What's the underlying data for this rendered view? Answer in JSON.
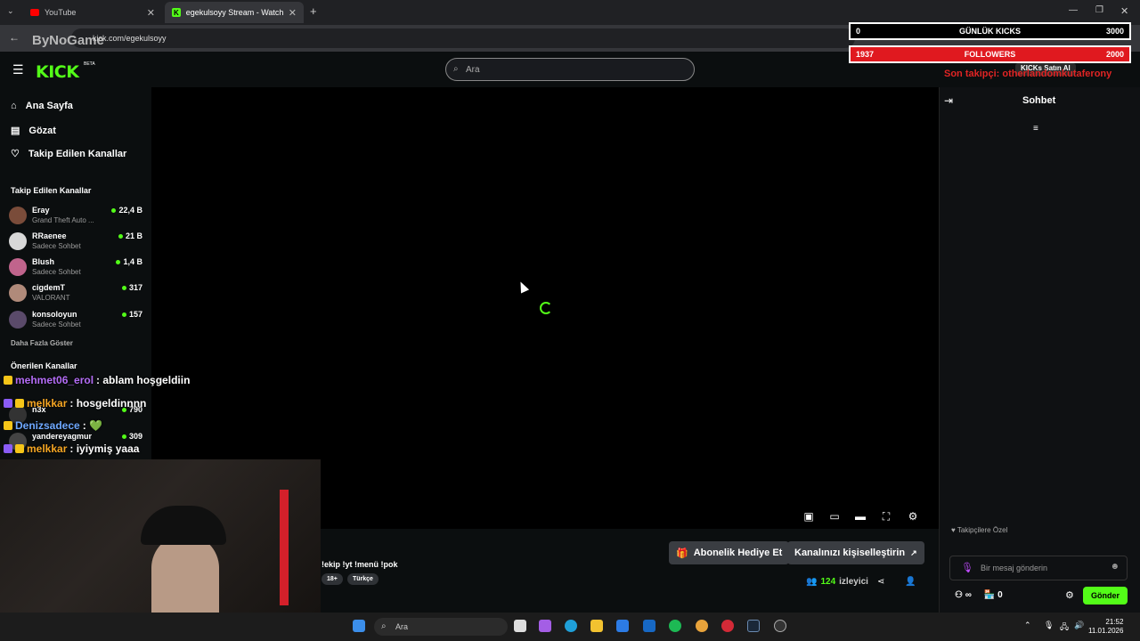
{
  "browser": {
    "tabs": [
      {
        "label": "YouTube",
        "active": false
      },
      {
        "label": "egekulsoyy Stream - Watch Live",
        "active": true
      }
    ],
    "new_tab_glyph": "+",
    "url": "kick.com/egekulsoyy"
  },
  "watermark": "ByNoGame",
  "kick": {
    "logo": "KICK",
    "beta": "BETA",
    "search_placeholder": "Ara",
    "accent": "#53fc18"
  },
  "sidebar": {
    "nav": [
      {
        "label": "Ana Sayfa",
        "icon": "home-icon"
      },
      {
        "label": "Gözat",
        "icon": "browse-icon"
      },
      {
        "label": "Takip Edilen Kanallar",
        "icon": "heart-icon"
      }
    ],
    "followed_title": "Takip Edilen Kanallar",
    "followed": [
      {
        "name": "Eray",
        "sub": "Grand Theft Auto ...",
        "viewers": "22,4 B"
      },
      {
        "name": "RRaenee",
        "sub": "Sadece Sohbet",
        "viewers": "21 B"
      },
      {
        "name": "Blush",
        "sub": "Sadece Sohbet",
        "viewers": "1,4 B"
      },
      {
        "name": "cigdemT",
        "sub": "VALORANT",
        "viewers": "317"
      },
      {
        "name": "konsoloyun",
        "sub": "Sadece Sohbet",
        "viewers": "157"
      }
    ],
    "show_more": "Daha Fazla Göster",
    "recommended_title": "Önerilen Kanallar",
    "recommended": [
      {
        "name": "n3x",
        "viewers": "790"
      },
      {
        "name": "yandereyagmur",
        "viewers": "309"
      }
    ]
  },
  "overlay_chat": [
    {
      "user": "mehmet06_erol",
      "color": "#b36cf5",
      "text": ": ablam hoşgeldiin"
    },
    {
      "user": "melkkar",
      "color": "#f5a623",
      "text": ": hosgeldinnnn"
    },
    {
      "user": "Denizsadece",
      "color": "#6ea8ff",
      "text": ": 💚"
    },
    {
      "user": "melkkar",
      "color": "#f5a623",
      "text": ": iyiymiş yaaa"
    }
  ],
  "overlay_stats": {
    "kicks": {
      "current": "0",
      "label": "GÜNLÜK KICKS",
      "goal": "3000"
    },
    "followers": {
      "current": "1937",
      "label": "FOLLOWERS",
      "goal": "2000"
    },
    "kicks_buy": "KICKs Satın Al",
    "last_follower": "Son takipçi: otherlandomkutaferony"
  },
  "stream": {
    "title": "!ekip !yt !menü !pok",
    "tags": [
      "18+",
      "Türkçe"
    ],
    "viewers": "124",
    "viewers_label": "izleyici",
    "gift_sub": "Abonelik Hediye Et",
    "customize": "Kanalınızı kişiselleştirin"
  },
  "chat": {
    "title": "Sohbet",
    "follower_only": "Takipçilere Özel",
    "placeholder": "Bir mesaj gönderin",
    "send": "Gönder",
    "points": "0"
  },
  "taskbar": {
    "search": "Ara",
    "time": "21:52",
    "date": "11.01.2026"
  }
}
